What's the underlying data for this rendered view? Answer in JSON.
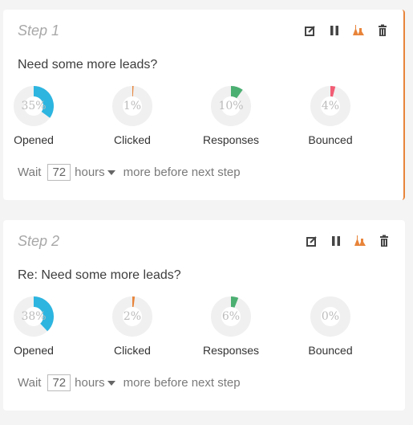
{
  "steps": [
    {
      "title": "Step 1",
      "subject": "Need some more leads?",
      "selected": true,
      "stats": [
        {
          "label": "Opened",
          "value": 35,
          "display": "35%",
          "color": "#2db5e0"
        },
        {
          "label": "Clicked",
          "value": 1,
          "display": "1%",
          "color": "#e8843a"
        },
        {
          "label": "Responses",
          "value": 10,
          "display": "10%",
          "color": "#4caf72"
        },
        {
          "label": "Bounced",
          "value": 4,
          "display": "4%",
          "color": "#f25c74"
        }
      ],
      "wait": {
        "prefix": "Wait",
        "amount": "72",
        "unit": "hours",
        "suffix": "more before next step"
      }
    },
    {
      "title": "Step 2",
      "subject": "Re: Need some more leads?",
      "selected": false,
      "stats": [
        {
          "label": "Opened",
          "value": 38,
          "display": "38%",
          "color": "#2db5e0"
        },
        {
          "label": "Clicked",
          "value": 2,
          "display": "2%",
          "color": "#e8843a"
        },
        {
          "label": "Responses",
          "value": 6,
          "display": "6%",
          "color": "#4caf72"
        },
        {
          "label": "Bounced",
          "value": 0,
          "display": "0%",
          "color": "#f25c74"
        }
      ],
      "wait": {
        "prefix": "Wait",
        "amount": "72",
        "unit": "hours",
        "suffix": "more before next step"
      }
    }
  ],
  "icons": [
    "edit-icon",
    "pause-icon",
    "ab-test-flask-icon",
    "trash-icon"
  ],
  "colors": {
    "accent": "#e8843a",
    "track": "#f0f0f0"
  }
}
